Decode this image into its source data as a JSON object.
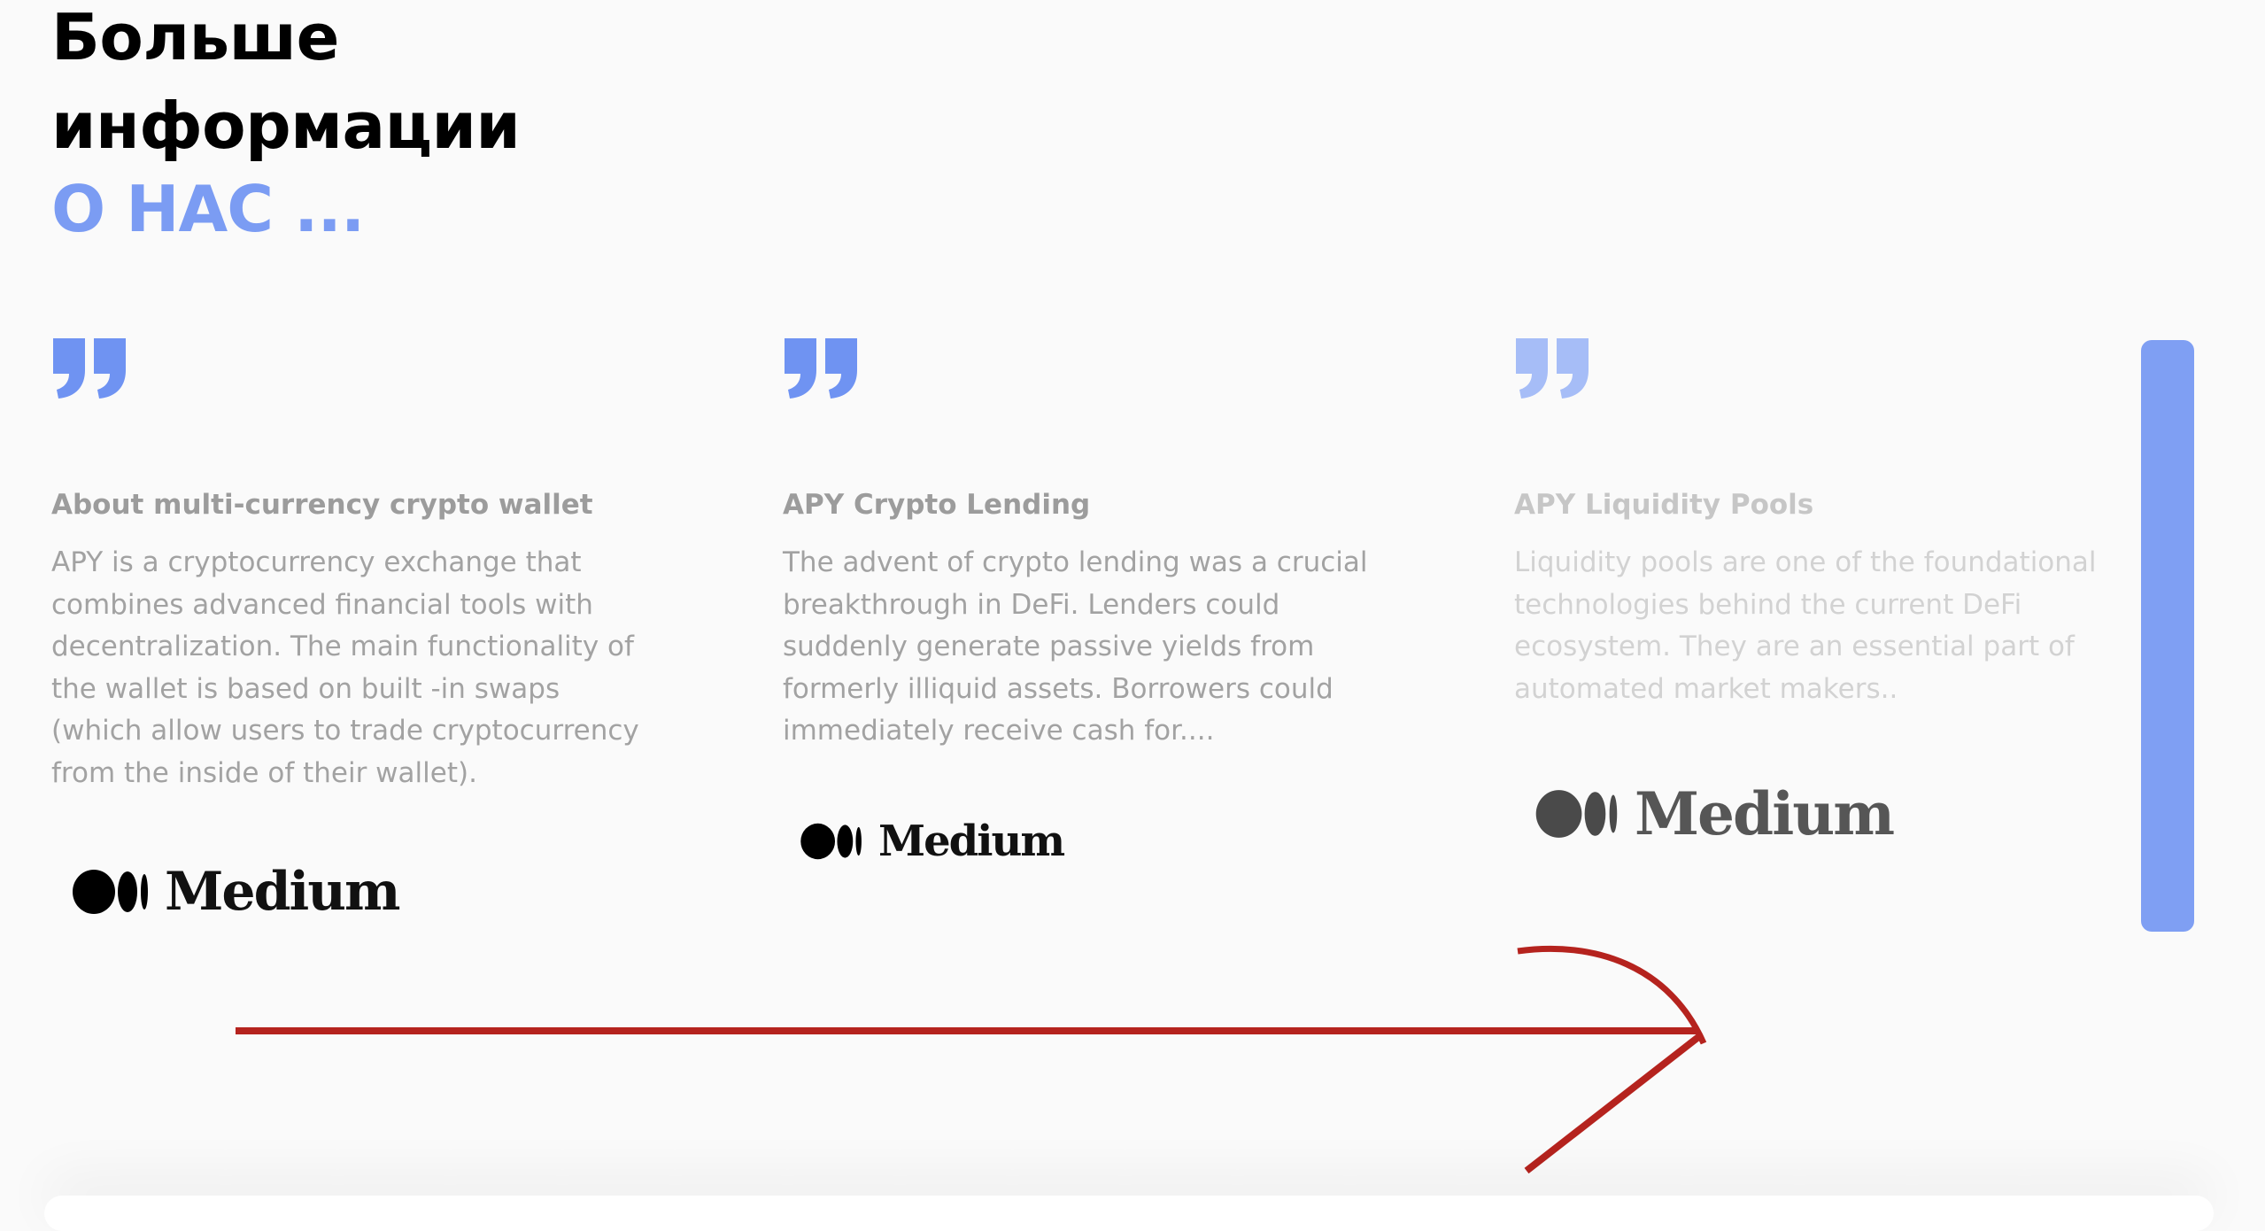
{
  "header": {
    "title_line1": "Больше",
    "title_line2": "информации",
    "subtitle": "О НАС ..."
  },
  "colors": {
    "accent": "#7b9cf3",
    "scrollbar": "#7f9ff3",
    "annotation_arrow": "#b5231e"
  },
  "cards": [
    {
      "icon": "quote-icon",
      "title": "About multi-currency crypto wallet",
      "text": "APY is a cryptocurrency exchange that combines advanced financial tools with decentralization. The main functionality of the wallet is based on built -in swaps (which allow users to trade cryptocurrency from the inside of their wallet).",
      "logo_text": "Medium"
    },
    {
      "icon": "quote-icon",
      "title": "APY Crypto Lending",
      "text": "The advent of crypto lending was a crucial breakthrough in DeFi. Lenders could suddenly generate passive yields from formerly illiquid assets. Borrowers could immediately receive cash for....",
      "logo_text": "Medium"
    },
    {
      "icon": "quote-icon",
      "title": "APY Liquidity Pools",
      "text": "Liquidity pools are one of the foundational technologies behind the current DeFi ecosystem. They are an essential part of automated market makers..",
      "logo_text": "Medium"
    }
  ]
}
